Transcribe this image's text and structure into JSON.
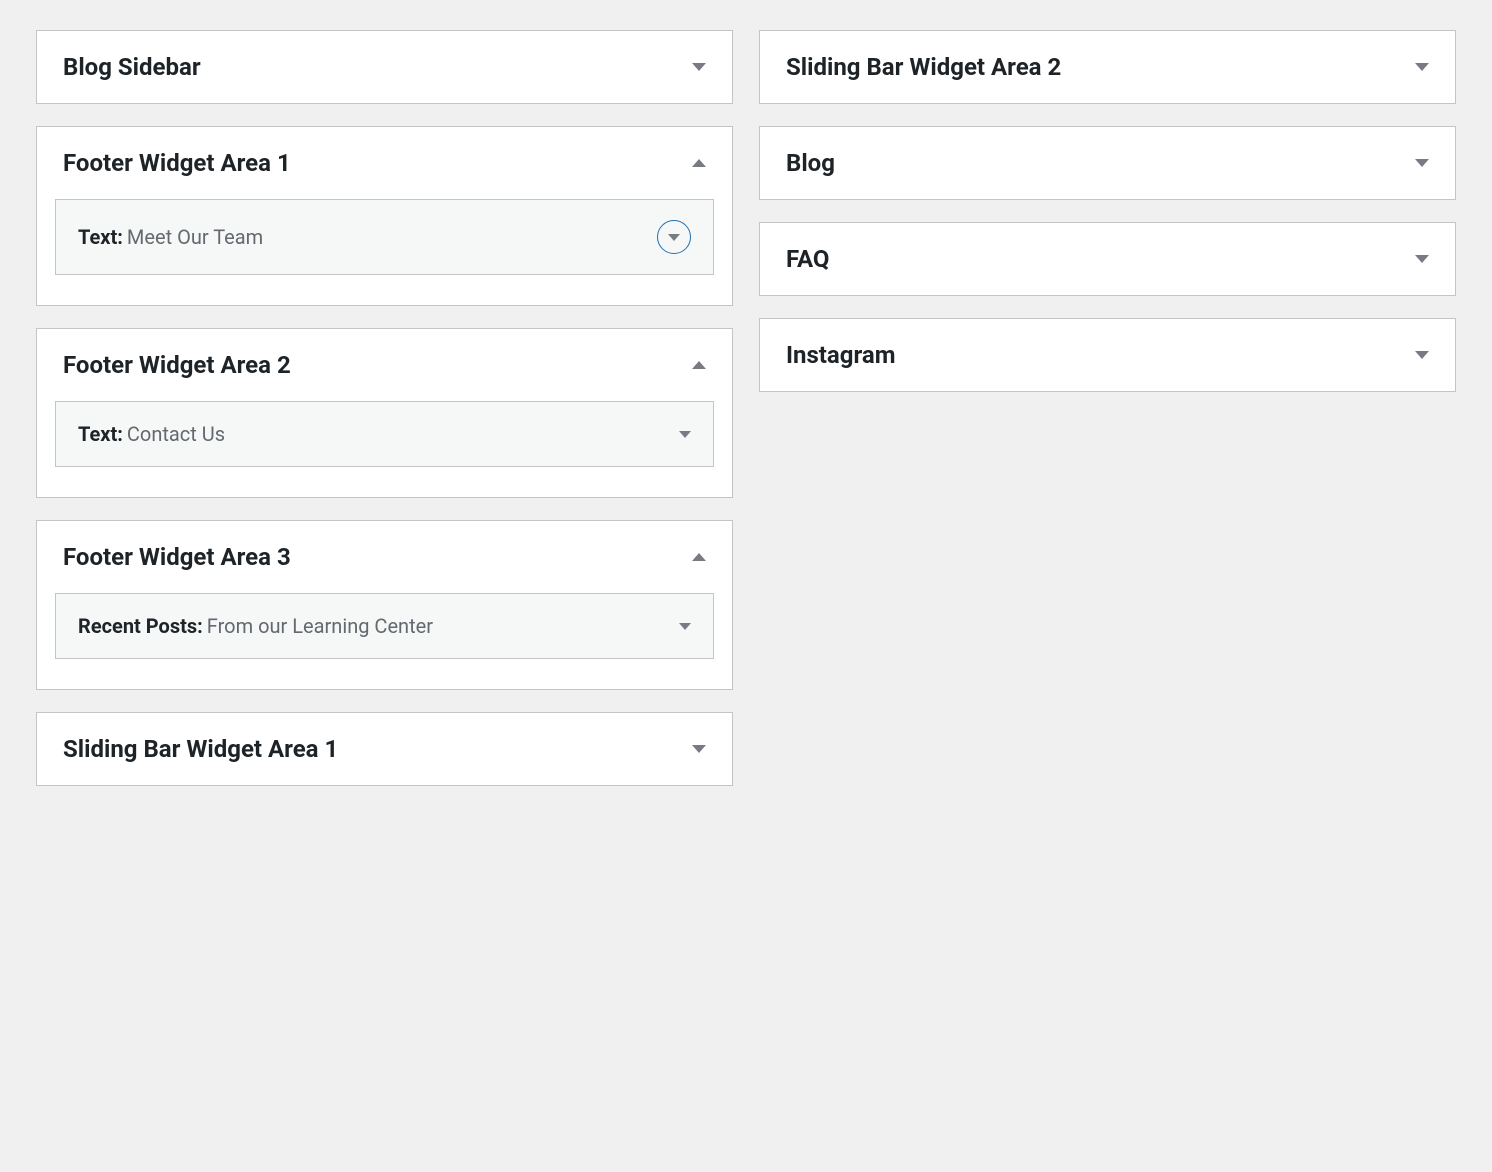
{
  "left": {
    "panels": [
      {
        "title": "Blog Sidebar",
        "expanded": false,
        "widgets": []
      },
      {
        "title": "Footer Widget Area 1",
        "expanded": true,
        "widgets": [
          {
            "kind": "Text",
            "title": "Meet Our Team",
            "focused": true
          }
        ]
      },
      {
        "title": "Footer Widget Area 2",
        "expanded": true,
        "widgets": [
          {
            "kind": "Text",
            "title": "Contact Us",
            "focused": false
          }
        ]
      },
      {
        "title": "Footer Widget Area 3",
        "expanded": true,
        "widgets": [
          {
            "kind": "Recent Posts",
            "title": "From our Learning Center",
            "focused": false
          }
        ]
      },
      {
        "title": "Sliding Bar Widget Area 1",
        "expanded": false,
        "widgets": []
      }
    ]
  },
  "right": {
    "panels": [
      {
        "title": "Sliding Bar Widget Area 2",
        "expanded": false
      },
      {
        "title": "Blog",
        "expanded": false
      },
      {
        "title": "FAQ",
        "expanded": false
      },
      {
        "title": "Instagram",
        "expanded": false
      }
    ]
  }
}
